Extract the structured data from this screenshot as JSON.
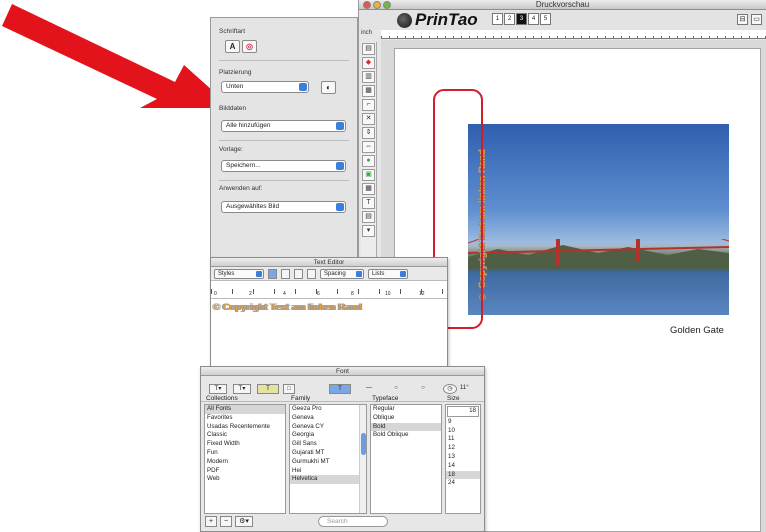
{
  "main_window": {
    "title": "Druckvorschau",
    "logo": "PrinTao",
    "pages": [
      "1",
      "2",
      "3",
      "4",
      "5"
    ],
    "active_page": "3",
    "ruler_unit": "inch",
    "caption": "Golden Gate",
    "copyright": "© Copyright Text am linken Rand"
  },
  "settings_panel": {
    "schriftart_label": "Schriftart",
    "platzierung_label": "Platzierung",
    "platzierung_value": "Unten",
    "bilddaten_label": "Bilddaten",
    "bilddaten_value": "Alle hinzufügen",
    "vorlage_label": "Vorlage:",
    "vorlage_value": "Speichern...",
    "anwenden_label": "Anwenden auf:",
    "anwenden_value": "Ausgewähltes Bild"
  },
  "text_editor": {
    "title": "Text Editor",
    "styles": "Styles",
    "spacing": "Spacing",
    "lists": "Lists",
    "ruler_marks": [
      "0",
      "2",
      "4",
      "6",
      "8",
      "10",
      "12"
    ],
    "content": "© Copyright Text am linken Rand"
  },
  "font_panel": {
    "title": "Font",
    "size_value": "11",
    "angle": "11°",
    "collections_header": "Collections",
    "family_header": "Family",
    "typeface_header": "Typeface",
    "size_header": "Size",
    "collections": [
      "All Fonts",
      "Favorites",
      "Usadas Recentemente",
      "Classic",
      "Fixed Width",
      "Fun",
      "Modern",
      "PDF",
      "Web"
    ],
    "families": [
      "Geeza Pro",
      "Geneva",
      "Geneva CY",
      "Georgia",
      "Gill Sans",
      "Gujarati MT",
      "Gurmukhi MT",
      "Hei",
      "Helvetica"
    ],
    "typefaces": [
      "Regular",
      "Oblique",
      "Bold",
      "Bold Oblique"
    ],
    "sizes": [
      "9",
      "10",
      "11",
      "12",
      "13",
      "14",
      "18",
      "24"
    ],
    "size_field": "18",
    "search_placeholder": "Search",
    "add": "+",
    "remove": "−"
  },
  "colors": {
    "arrow": "#e2131b",
    "highlight_frame": "#d21e2a",
    "copyright_text": "#e09c4a",
    "accent": "#3a7fdc"
  }
}
